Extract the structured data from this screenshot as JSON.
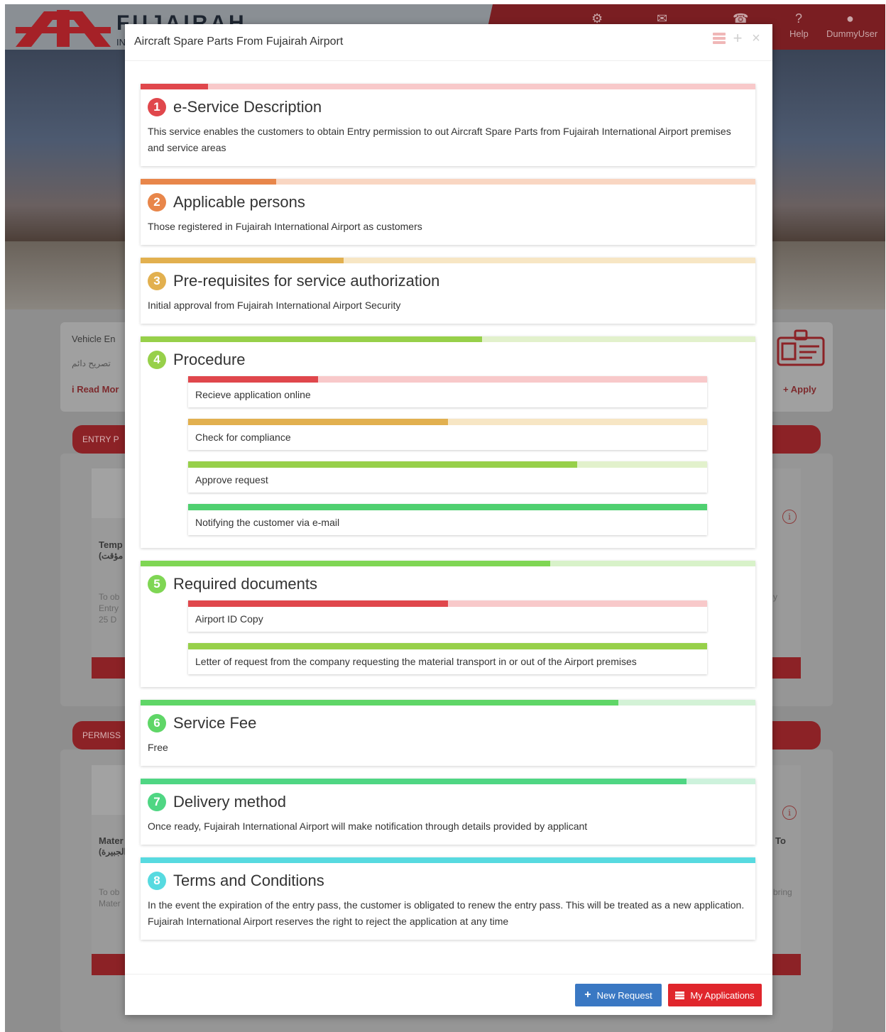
{
  "background": {
    "brand": "FUJAIRAH",
    "brand_sub": "IN",
    "top_nav": [
      {
        "icon": "gears-icon",
        "label": ""
      },
      {
        "icon": "mail-icon",
        "label": ""
      },
      {
        "icon": "phone-icon",
        "label": ""
      },
      {
        "icon": "question-icon",
        "label": "Help"
      },
      {
        "icon": "user-icon",
        "label": "DummyUser"
      }
    ],
    "vehicle_card": {
      "title": "Vehicle En",
      "arabic": "تصريح دائم",
      "read_more": "Read Mor",
      "apply": "Apply"
    },
    "entry_tab": "ENTRY P",
    "permission_tab": "PERMISS",
    "temp_card": {
      "title": "Temp",
      "arabic": "(مؤقت",
      "desc_1": "To ob",
      "desc_2": "Entry",
      "desc_3": "25 D",
      "right": "y"
    },
    "material_card": {
      "title": "Mater",
      "arabic": "(الجبيرة",
      "desc_1": "To ob",
      "desc_2": "Mater",
      "right_title": "To",
      "right_desc": "bring"
    }
  },
  "modal": {
    "title": "Aircraft Spare Parts From Fujairah Airport",
    "sections": [
      {
        "num": "1",
        "title": "e-Service Description",
        "color": "#e0474c",
        "track": "#f8c9ca",
        "fill": 0.11,
        "body": "This service enables the customers to obtain Entry permission to out Aircraft Spare Parts from Fujairah International Airport premises and service areas"
      },
      {
        "num": "2",
        "title": "Applicable persons",
        "color": "#e8864a",
        "track": "#f9d6c2",
        "fill": 0.22,
        "body": "Those registered in Fujairah International Airport as customers"
      },
      {
        "num": "3",
        "title": "Pre-requisites for service authorization",
        "color": "#e2b04f",
        "track": "#f7e6c4",
        "fill": 0.33,
        "body": "Initial approval from Fujairah International Airport Security"
      },
      {
        "num": "4",
        "title": "Procedure",
        "color": "#97d04a",
        "track": "#e2f1cc",
        "fill": 0.555,
        "items": [
          {
            "text": "Recieve application online",
            "color": "#e0474c",
            "track": "#f8c9ca",
            "fill": 0.25
          },
          {
            "text": "Check for compliance",
            "color": "#e2b04f",
            "track": "#f7e6c4",
            "fill": 0.5
          },
          {
            "text": "Approve request",
            "color": "#97d04a",
            "track": "#e2f1cc",
            "fill": 0.75
          },
          {
            "text": "Notifying the customer via e-mail",
            "color": "#4fd070",
            "track": "#cdf1d6",
            "fill": 1.0
          }
        ]
      },
      {
        "num": "5",
        "title": "Required documents",
        "color": "#7fd654",
        "track": "#d8f2c9",
        "fill": 0.666,
        "items": [
          {
            "text": "Airport ID Copy",
            "color": "#e0474c",
            "track": "#f8c9ca",
            "fill": 0.5
          },
          {
            "text": "Letter of request from the company requesting the material transport in or out of the Airport premises",
            "color": "#97d04a",
            "track": "#e2f1cc",
            "fill": 1.0
          }
        ]
      },
      {
        "num": "6",
        "title": "Service Fee",
        "color": "#5fd667",
        "track": "#d3f2d6",
        "fill": 0.777,
        "body": "Free"
      },
      {
        "num": "7",
        "title": "Delivery method",
        "color": "#4fd683",
        "track": "#cdf2dc",
        "fill": 0.888,
        "body": "Once ready, Fujairah International Airport will make notification through details provided by applicant"
      },
      {
        "num": "8",
        "title": "Terms and Conditions",
        "color": "#57dae0",
        "track": "#cbf3f5",
        "fill": 1.0,
        "body": "In the event the expiration of the entry pass, the customer is obligated to renew the entry pass. This will be treated as a new application. Fujairah International Airport reserves the right to reject the application at any time"
      }
    ],
    "footer": {
      "new_request": "New Request",
      "my_applications": "My Applications"
    }
  }
}
